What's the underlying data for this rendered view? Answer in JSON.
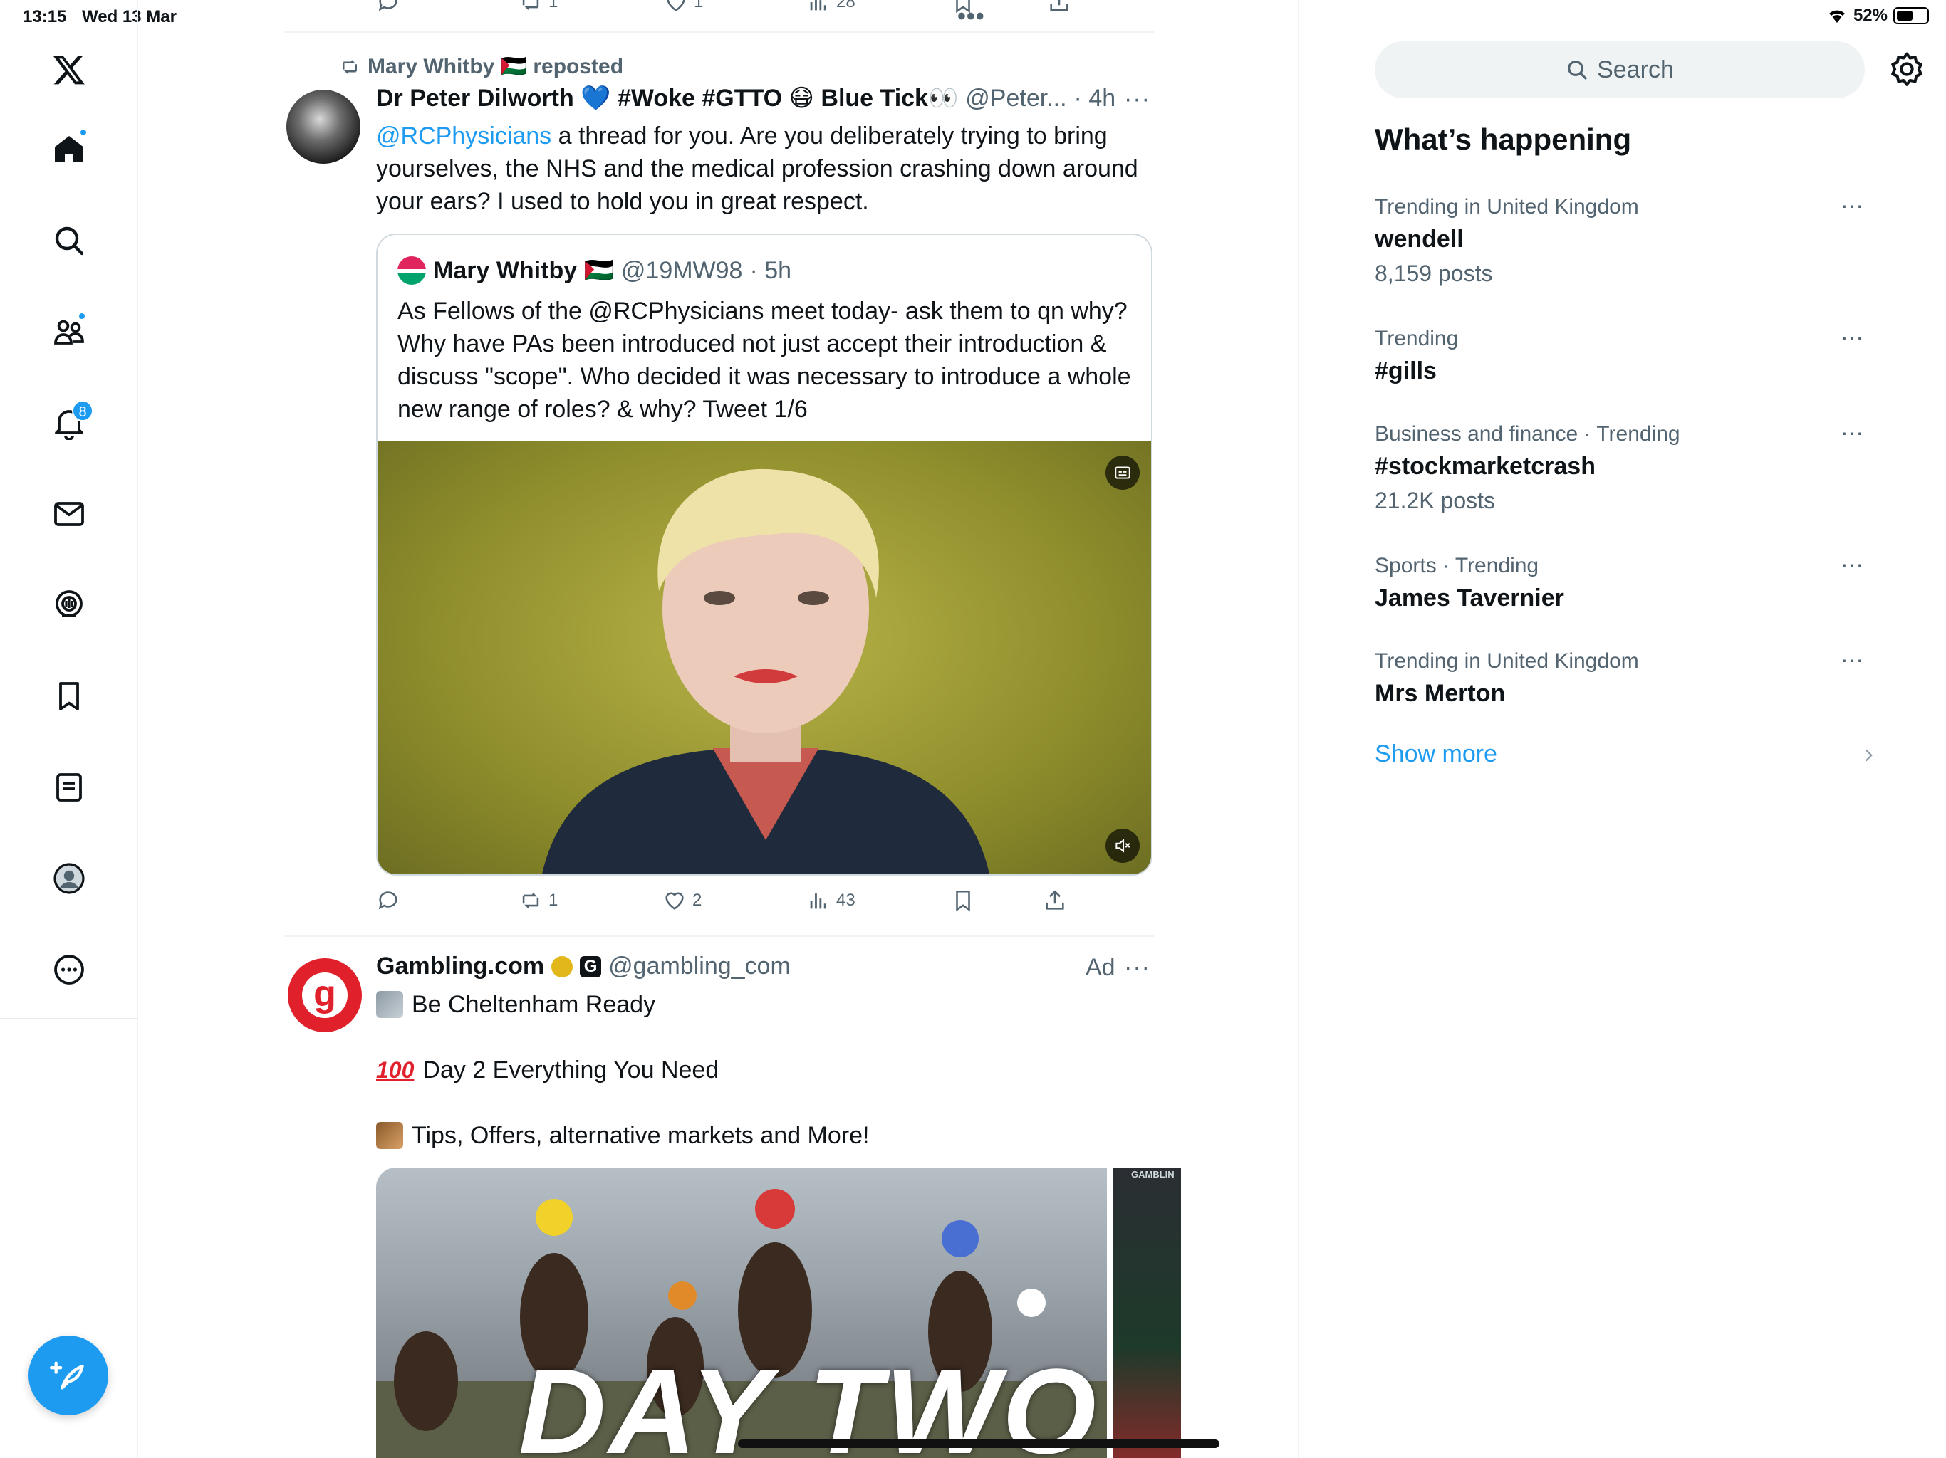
{
  "status_bar": {
    "time": "13:15",
    "date": "Wed 13 Mar",
    "battery": "52%",
    "battery_level": 0.52
  },
  "nav": {
    "notifications_badge": "8"
  },
  "top_actions": {
    "retweets": "1",
    "likes": "1",
    "views": "28"
  },
  "tweet1": {
    "reposted_by": "Mary Whitby 🇵🇸 reposted",
    "author_name": "Dr Peter Dilworth 💙 #Woke #GTTO 😷 Blue Tick👀",
    "author_handle": "@Peter...",
    "time": "· 4h",
    "mention": "@RCPhysicians",
    "text": " a thread for you. Are you deliberately trying to bring yourselves, the NHS and the medical profession crashing down around your ears? I used to hold you in great respect.",
    "quote": {
      "author_name": "Mary Whitby 🇵🇸",
      "author_handle": "@19MW98",
      "time": "· 5h",
      "text": "As Fellows of the @RCPhysicians meet today- ask them to qn why? Why have PAs been introduced not just accept their introduction & discuss \"scope\". Who decided it was necessary to introduce a whole new range of roles? & why? Tweet 1/6"
    },
    "actions": {
      "retweets": "1",
      "likes": "2",
      "views": "43"
    }
  },
  "ad": {
    "author_name": "Gambling.com",
    "author_handle": "@gambling_com",
    "ad_label": "Ad",
    "line1": "Be Cheltenham Ready",
    "line2": "Day 2 Everything You Need",
    "line3": "Tips, Offers, alternative markets and More!",
    "promo_text": "DAY TWO",
    "promo_small": "GAMBLIN"
  },
  "sidebar": {
    "search_placeholder": "Search",
    "heading": "What’s happening",
    "trends": [
      {
        "category": "Trending in United Kingdom",
        "topic": "wendell",
        "count": "8,159 posts"
      },
      {
        "category": "Trending",
        "topic": "#gills",
        "count": ""
      },
      {
        "category": "Business and finance · Trending",
        "topic": "#stockmarketcrash",
        "count": "21.2K posts"
      },
      {
        "category": "Sports · Trending",
        "topic": "James Tavernier",
        "count": ""
      },
      {
        "category": "Trending in United Kingdom",
        "topic": "Mrs Merton",
        "count": ""
      }
    ],
    "show_more": "Show more"
  },
  "colors": {
    "accent": "#1d9bf0",
    "text": "#0f1419",
    "muted": "#536471",
    "border": "#eff3f4"
  }
}
